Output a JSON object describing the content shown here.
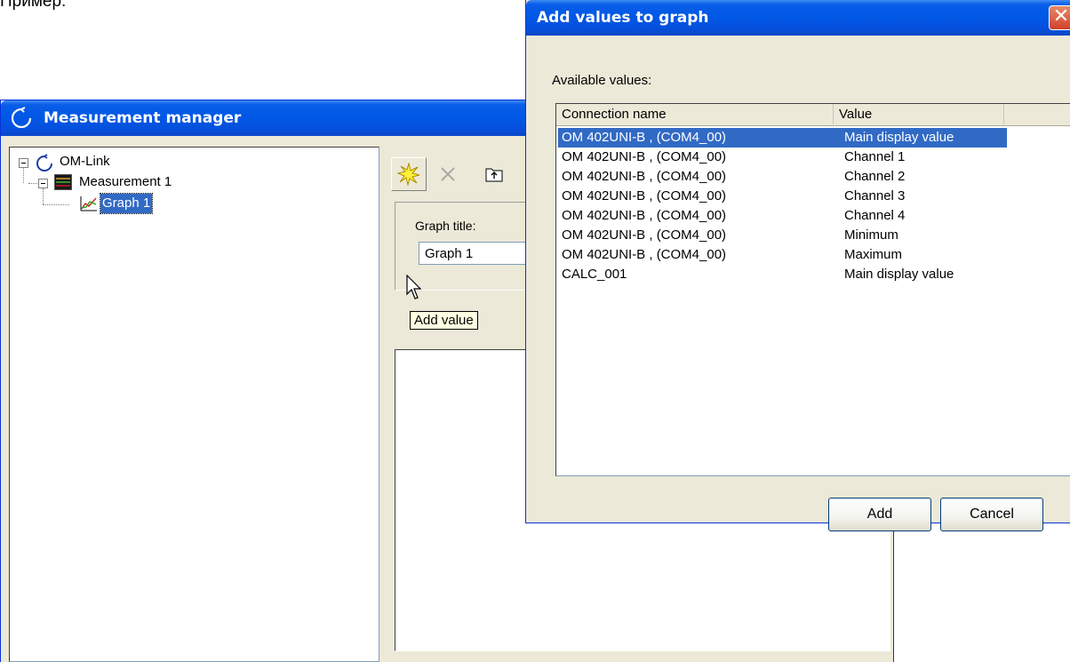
{
  "page_caption": "Пример:",
  "measurement_manager": {
    "title": "Measurement manager",
    "tree": {
      "root": "OM-Link",
      "measurement": "Measurement 1",
      "graph": "Graph 1"
    },
    "toolbar": {
      "add_value_tooltip": "Add value"
    },
    "graph_title_label": "Graph title:",
    "graph_title_value": "Graph 1"
  },
  "dialog": {
    "title": "Add values to graph",
    "close_glyph": "✕",
    "available_label": "Available values:",
    "columns": [
      "Connection name",
      "Value"
    ],
    "rows": [
      {
        "connection": "OM 402UNI-B , (COM4_00)",
        "value": "Main display value",
        "selected": true
      },
      {
        "connection": "OM 402UNI-B , (COM4_00)",
        "value": "Channel 1"
      },
      {
        "connection": "OM 402UNI-B , (COM4_00)",
        "value": "Channel 2"
      },
      {
        "connection": "OM 402UNI-B , (COM4_00)",
        "value": "Channel 3"
      },
      {
        "connection": "OM 402UNI-B , (COM4_00)",
        "value": "Channel 4"
      },
      {
        "connection": "OM 402UNI-B , (COM4_00)",
        "value": "Minimum"
      },
      {
        "connection": "OM 402UNI-B , (COM4_00)",
        "value": "Maximum"
      },
      {
        "connection": "CALC_001",
        "value": "Main display value"
      }
    ],
    "add_button": "Add",
    "cancel_button": "Cancel"
  },
  "colors": {
    "titlebar": "#0058e6",
    "selection": "#316ac5",
    "face": "#ece9d8"
  }
}
